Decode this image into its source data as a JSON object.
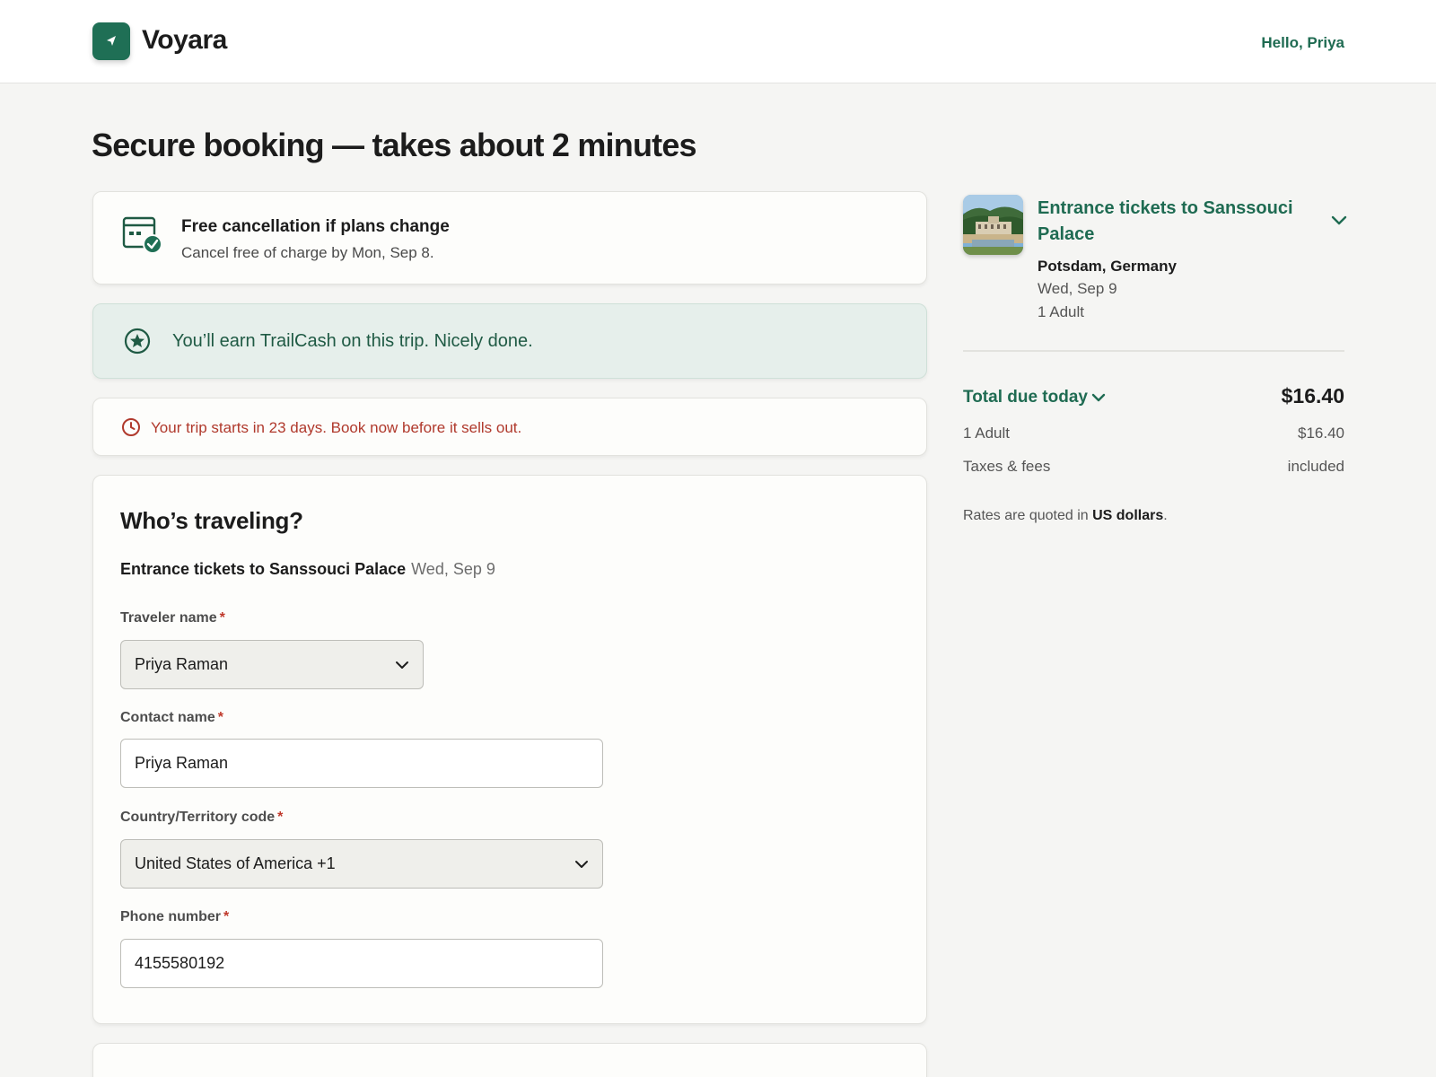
{
  "header": {
    "brand": "Voyara",
    "greeting": "Hello, Priya"
  },
  "page": {
    "title": "Secure booking — takes about 2 minutes"
  },
  "cancellation": {
    "title": "Free cancellation if plans change",
    "subtitle": "Cancel free of charge by Mon, Sep 8."
  },
  "rewards": {
    "message": "You’ll earn TrailCash on this trip. Nicely done."
  },
  "urgency": {
    "message": "Your trip starts in 23 days. Book now before it sells out."
  },
  "travelers": {
    "heading": "Who’s traveling?",
    "activity_name": "Entrance tickets to Sanssouci Palace",
    "activity_date": "Wed, Sep 9",
    "fields": {
      "traveler_name": {
        "label": "Traveler name",
        "required_mark": "*",
        "value": "Priya Raman"
      },
      "contact_name": {
        "label": "Contact name",
        "required_mark": "*",
        "value": "Priya Raman"
      },
      "country_code": {
        "label": "Country/Territory code",
        "required_mark": "*",
        "value": "United States of America +1"
      },
      "phone_number": {
        "label": "Phone number",
        "required_mark": "*",
        "value": "4155580192"
      }
    }
  },
  "summary": {
    "title": "Entrance tickets to Sanssouci Palace",
    "location": "Potsdam, Germany",
    "date": "Wed, Sep 9",
    "quantity": "1 Adult",
    "total_label": "Total due today",
    "total_amount": "$16.40",
    "lines": [
      {
        "label": "1 Adult",
        "value": "$16.40"
      },
      {
        "label": "Taxes & fees",
        "value": "included"
      }
    ],
    "rates_prefix": "Rates are quoted in",
    "rates_currency": "US dollars",
    "rates_suffix": "."
  },
  "colors": {
    "brand": "#1f6f55",
    "accent_text": "#1f6b52",
    "urgency": "#b0392c",
    "rewards_bg": "#e6efeb"
  }
}
